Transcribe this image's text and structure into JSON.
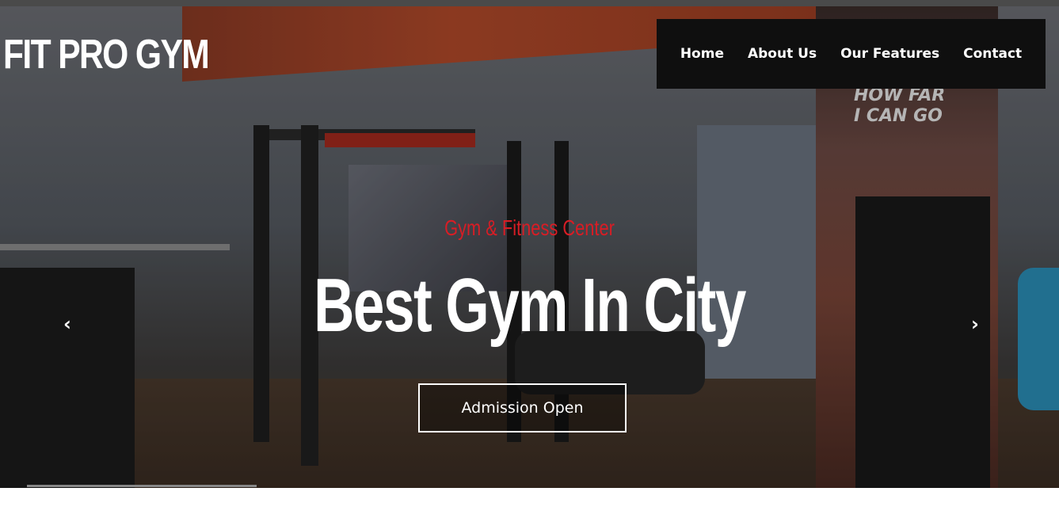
{
  "brand": {
    "logo_text": "FIT PRO GYM"
  },
  "nav": {
    "items": [
      {
        "label": "Home"
      },
      {
        "label": "About Us"
      },
      {
        "label": "Our Features"
      },
      {
        "label": "Contact"
      }
    ]
  },
  "hero": {
    "subtitle": "Gym & Fitness Center",
    "headline": "Best Gym In City",
    "cta_label": "Admission Open",
    "prev_arrow": "‹",
    "next_arrow": "›",
    "banner_slogan": "HOW FAR\nI CAN GO"
  },
  "colors": {
    "accent_red": "#d81d25",
    "nav_background": "#0f0f0f",
    "text_white": "#ffffff"
  },
  "icons": {
    "prev": "chevron-left-icon",
    "next": "chevron-right-icon"
  }
}
